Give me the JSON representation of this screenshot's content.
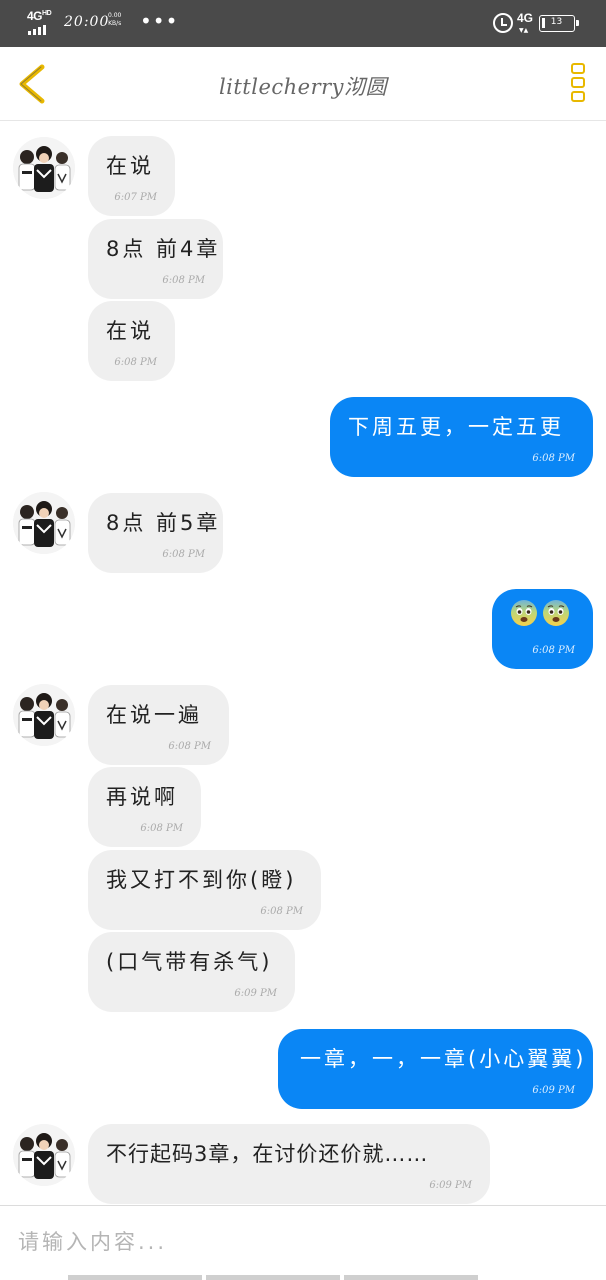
{
  "status_bar": {
    "network": "4G",
    "network_sup": "HD",
    "time": "20:00",
    "speed_value": "0.00",
    "speed_unit": "KB/s",
    "dots": "•••",
    "network_right": "4G",
    "battery": "13"
  },
  "header": {
    "title": "littlecherry沏圆"
  },
  "messages": [
    {
      "side": "in",
      "text": "在说",
      "time": "6:07 PM"
    },
    {
      "side": "in",
      "text": "8点 前4章",
      "time": "6:08 PM"
    },
    {
      "side": "in",
      "text": "在说",
      "time": "6:08 PM"
    },
    {
      "side": "out",
      "text": "下周五更，一定五更",
      "time": "6:08 PM"
    },
    {
      "side": "in",
      "text": "8点 前5章",
      "time": "6:08 PM"
    },
    {
      "side": "out",
      "emoji": [
        "fearful-face-emoji",
        "fearful-face-emoji"
      ],
      "time": "6:08 PM"
    },
    {
      "side": "in",
      "text": "在说一遍",
      "time": "6:08 PM"
    },
    {
      "side": "in",
      "text": "再说啊",
      "time": "6:08 PM"
    },
    {
      "side": "in",
      "text": "我又打不到你(瞪)",
      "time": "6:08 PM"
    },
    {
      "side": "in",
      "text": "(口气带有杀气)",
      "time": "6:09 PM"
    },
    {
      "side": "out",
      "text": "一章，一，一章(小心翼翼)",
      "time": "6:09 PM"
    },
    {
      "side": "in",
      "text": "不行起码3章，在讨价还价就……",
      "time": "6:09 PM"
    }
  ],
  "input": {
    "placeholder": "请输入内容..."
  },
  "colors": {
    "accent": "#e8b800",
    "outgoing_bubble": "#0a86f5",
    "incoming_bubble": "#efefef",
    "status_bar": "#4a4a4a"
  }
}
